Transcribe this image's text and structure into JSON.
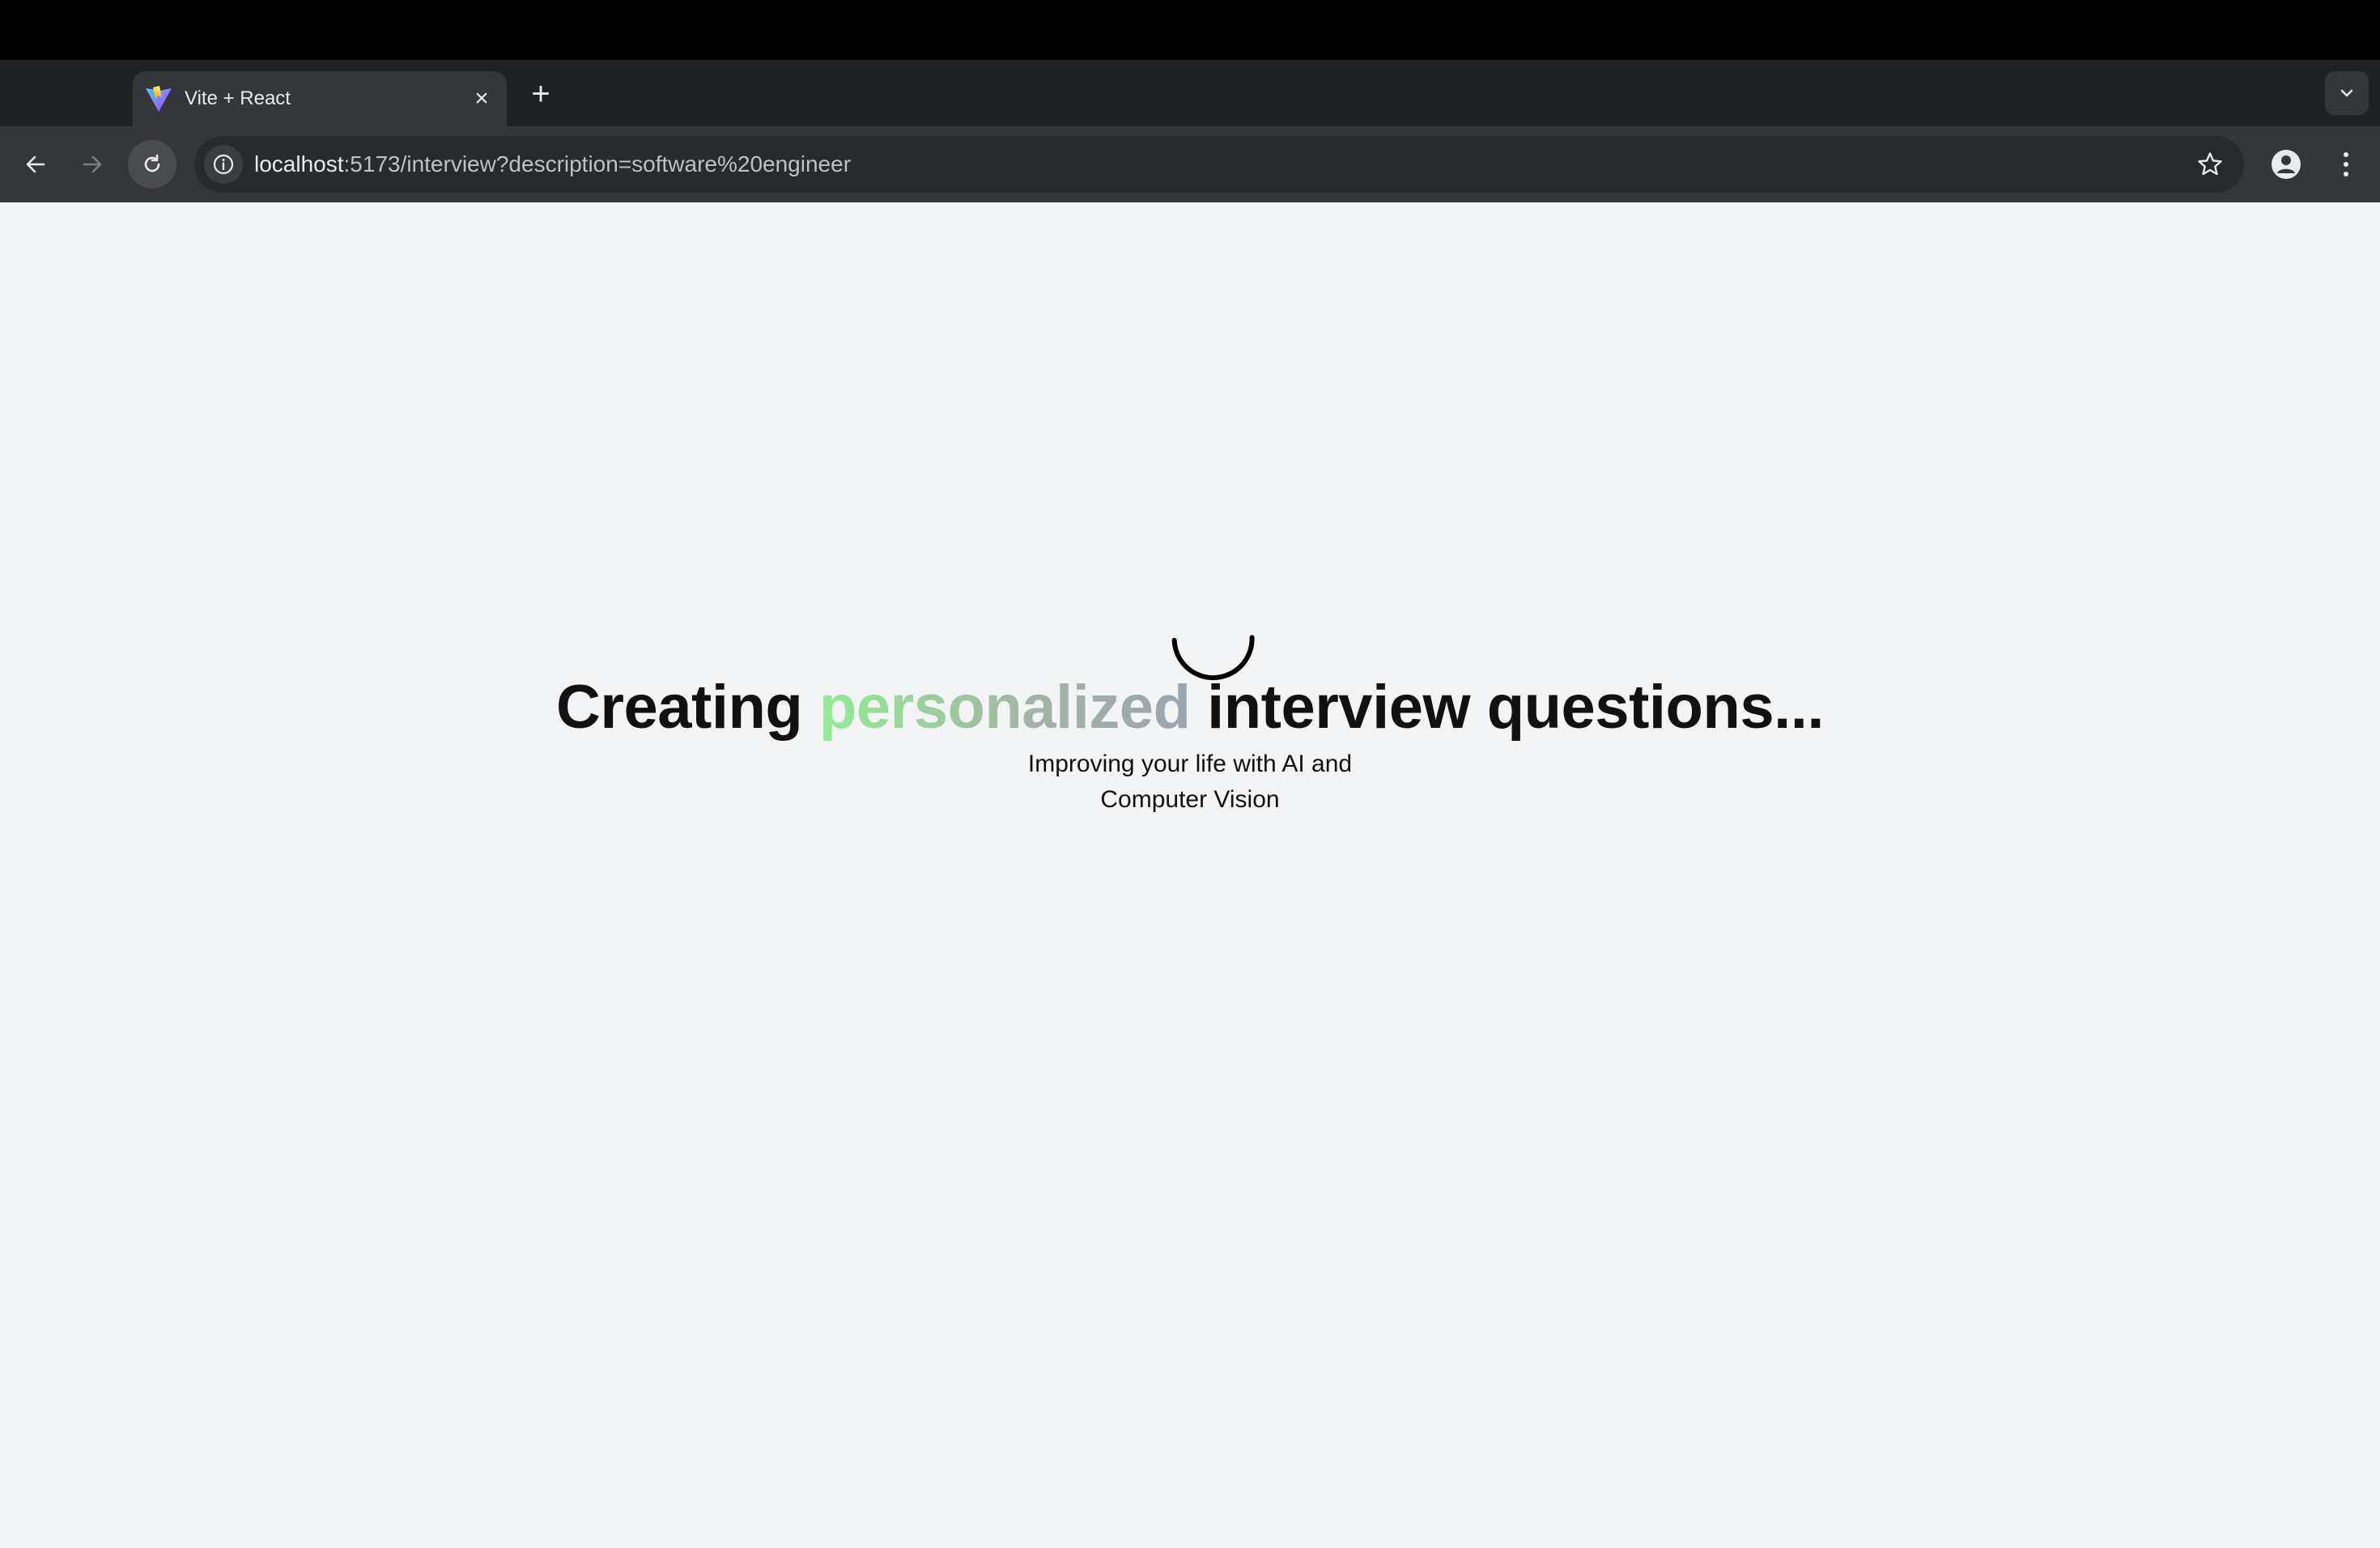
{
  "browser": {
    "tab": {
      "title": "Vite + React",
      "favicon": "vite-logo-icon",
      "close_icon": "close-icon"
    },
    "new_tab_icon": "plus-icon",
    "tab_search_icon": "chevron-down-icon",
    "toolbar": {
      "back_icon": "arrow-left-icon",
      "forward_icon": "arrow-right-icon",
      "reload_icon": "reload-icon",
      "site_info_icon": "info-icon",
      "url_host": "localhost",
      "url_rest": ":5173/interview?description=software%20engineer",
      "bookmark_icon": "star-icon",
      "profile_icon": "profile-icon",
      "menu_icon": "kebab-menu-icon"
    },
    "colors": {
      "frame": "#202124",
      "toolbar": "#35363a",
      "omnibox": "#282a2d",
      "text": "#e8eaed"
    }
  },
  "page": {
    "loading_icon": "spinner-icon",
    "headline": {
      "before": "Creating ",
      "highlight": "personalized",
      "after": " interview questions..."
    },
    "subtitle_line1": "Improving your life with AI and",
    "subtitle_line2": "Computer Vision",
    "colors": {
      "background": "#f3f4f6",
      "text": "#111111",
      "highlight_start": "#90ee90",
      "highlight_end": "#9ca3af"
    }
  }
}
